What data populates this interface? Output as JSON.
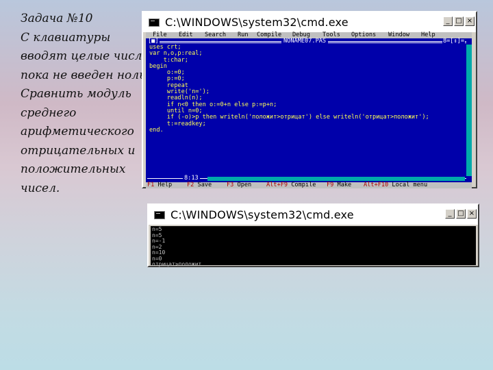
{
  "task": {
    "lines": [
      "Задача №10",
      "С клавиатуры",
      "вводят целые числа,",
      "пока не введен ноль.",
      "Сравнить модуль",
      "среднего",
      "арифметического",
      "отрицательных и",
      "положительных",
      "чисел."
    ]
  },
  "ide_window": {
    "title": "C:\\WINDOWS\\system32\\cmd.exe",
    "buttons": {
      "minimize": "_",
      "maximize": "□",
      "close": "×"
    },
    "menu": [
      "File",
      "Edit",
      "Search",
      "Run",
      "Compile",
      "Debug",
      "Tools",
      "Options",
      "Window",
      "Help"
    ],
    "editor": {
      "close_box": "[■]",
      "file_name": "NONAME07.PAS",
      "window_number": "8=[↕]=",
      "cursor_position": "8:13",
      "code_lines": [
        "uses crt;",
        "var n,o,p:real;",
        "    t:char;",
        "begin",
        "     o:=0;",
        "     p:=0;",
        "     repeat",
        "     write('n=');",
        "     readln(n);",
        "     if n<0 then o:=0+n else p:=p+n;",
        "     until n=0;",
        "     if (-o)>p then writeln('положит>отрицат') else writeln('отрицат>положит');",
        "     t:=readkey;",
        "end."
      ]
    },
    "status": [
      {
        "key": "F1",
        "label": " Help"
      },
      {
        "key": "F2",
        "label": " Save"
      },
      {
        "key": "F3",
        "label": " Open"
      },
      {
        "key": "Alt+F9",
        "label": " Compile"
      },
      {
        "key": "F9",
        "label": " Make"
      },
      {
        "key": "Alt+F10",
        "label": " Local menu"
      }
    ]
  },
  "output_window": {
    "title": "C:\\WINDOWS\\system32\\cmd.exe",
    "buttons": {
      "minimize": "_",
      "maximize": "□",
      "close": "×"
    },
    "lines": [
      "n=5",
      "n=5",
      "n=-1",
      "n=2",
      "n=10",
      "n=0",
      "отрицат>положит"
    ]
  }
}
